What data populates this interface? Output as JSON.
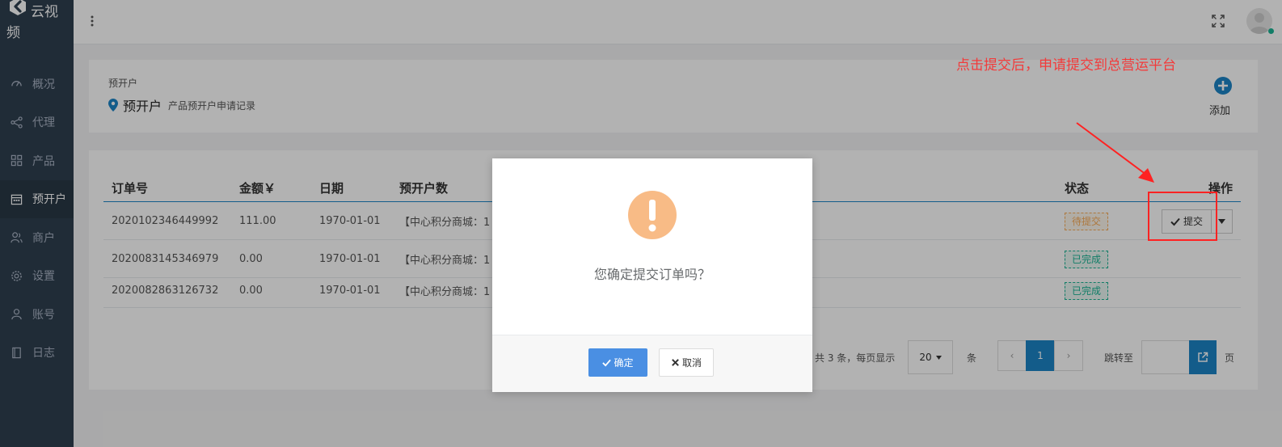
{
  "app": {
    "logo_text": "云视频"
  },
  "sidebar": {
    "items": [
      {
        "label": "概况",
        "icon": "dashboard-icon"
      },
      {
        "label": "代理",
        "icon": "share-icon"
      },
      {
        "label": "产品",
        "icon": "grid-icon"
      },
      {
        "label": "预开户",
        "icon": "calendar-icon",
        "active": true
      },
      {
        "label": "商户",
        "icon": "users-icon"
      },
      {
        "label": "设置",
        "icon": "gear-icon"
      },
      {
        "label": "账号",
        "icon": "user-icon"
      },
      {
        "label": "日志",
        "icon": "book-icon"
      }
    ]
  },
  "header": {
    "breadcrumb": "预开户",
    "title": "预开户",
    "subtitle": "产品预开户申请记录",
    "add_label": "添加"
  },
  "table": {
    "columns": [
      "订单号",
      "金额￥",
      "日期",
      "预开户数",
      "状态",
      "操作"
    ],
    "rows": [
      {
        "order": "2020102346449992",
        "amount": "111.00",
        "date": "1970-01-01",
        "count": "【中心积分商城：1",
        "status": "待提交"
      },
      {
        "order": "2020083145346979",
        "amount": "0.00",
        "date": "1970-01-01",
        "count": "【中心积分商城：1",
        "status": "已完成"
      },
      {
        "order": "2020082863126732",
        "amount": "0.00",
        "date": "1970-01-01",
        "count": "【中心积分商城：1",
        "status": "已完成"
      }
    ],
    "submit_label": "提交"
  },
  "pagination": {
    "total_text": "共 3 条，每页显示",
    "page_size": "20",
    "unit": "条",
    "prev": "‹",
    "current": "1",
    "next": "›",
    "jump_label": "跳转至",
    "page_unit": "页"
  },
  "annotation": {
    "text": "点击提交后，申请提交到总营运平台",
    "color": "#f23b3b"
  },
  "modal": {
    "message": "您确定提交订单吗？",
    "ok_label": "确定",
    "cancel_label": "取消"
  },
  "colors": {
    "sidebar_bg": "#2f4050",
    "primary": "#1c84c6",
    "warning": "#f8ac59",
    "success": "#1ab394",
    "modal_ok": "#4a8fe3"
  }
}
